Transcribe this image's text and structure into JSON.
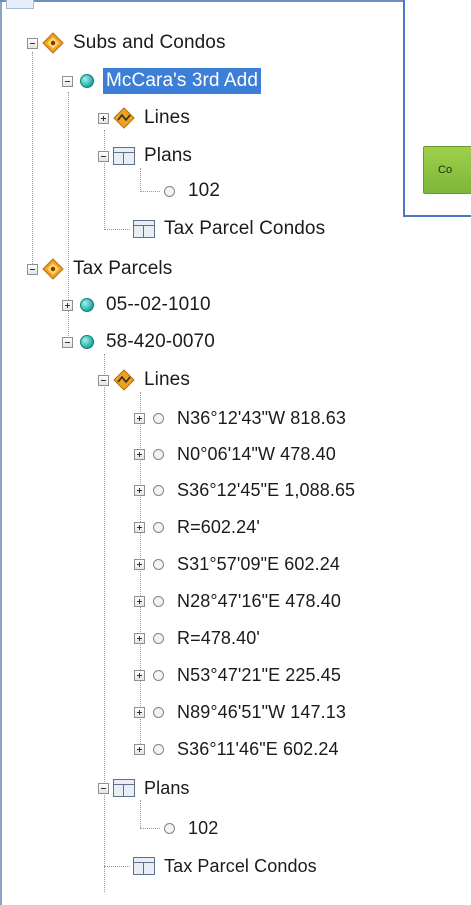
{
  "overlay": {
    "button_label": "Co"
  },
  "tree": {
    "subs_and_condos": {
      "label": "Subs and Condos",
      "mccaras": {
        "label": "McCara's 3rd Add",
        "lines": "Lines",
        "plans": "Plans",
        "plan_102": "102",
        "tax_parcel_condos": "Tax Parcel Condos"
      }
    },
    "tax_parcels": {
      "label": "Tax Parcels",
      "parcel_a": "05--02-1010",
      "parcel_b": "58-420-0070",
      "lines": "Lines",
      "line_items": [
        "N36°12'43\"W  818.63",
        "N0°06'14\"W  478.40",
        "S36°12'45\"E  1,088.65",
        "R=602.24'",
        "S31°57'09\"E  602.24",
        "N28°47'16\"E  478.40",
        "R=478.40'",
        "N53°47'21\"E  225.45",
        "N89°46'51\"W  147.13",
        "S36°11'46\"E  602.24"
      ],
      "plans": "Plans",
      "plan_102": "102",
      "tax_parcel_condos": "Tax Parcel Condos"
    }
  },
  "colors": {
    "selection": "#3d7fd6",
    "button_green": "#8cc443",
    "teal_dot": "#1fa9a0",
    "diamond": "#f0a21c"
  }
}
